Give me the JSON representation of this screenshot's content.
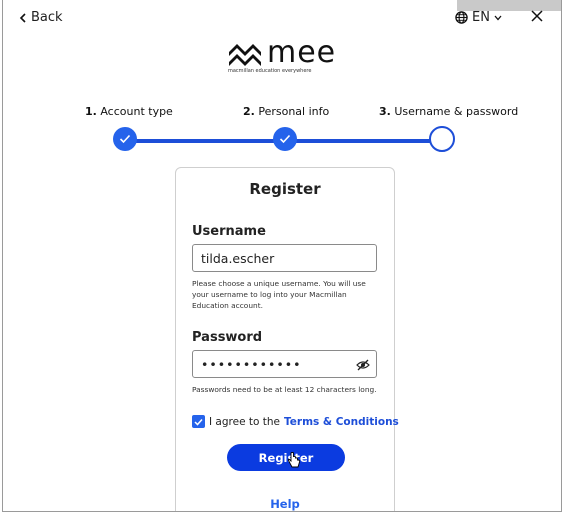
{
  "topbar": {
    "back_label": "Back",
    "language_label": "EN"
  },
  "brand": {
    "wordmark": "mee",
    "tagline": "macmillan education everywhere"
  },
  "steps": [
    {
      "number": "1.",
      "label": "Account type",
      "state": "done"
    },
    {
      "number": "2.",
      "label": "Personal info",
      "state": "done"
    },
    {
      "number": "3.",
      "label": "Username & password",
      "state": "current"
    }
  ],
  "form": {
    "title": "Register",
    "username": {
      "label": "Username",
      "value": "tilda.escher",
      "hint": "Please choose a unique username. You will use your username to log into your Macmillan Education account."
    },
    "password": {
      "label": "Password",
      "value": "••••••••••••",
      "hint": "Passwords need to be at least 12 characters long."
    },
    "agree": {
      "prefix": "I agree to the",
      "link": "Terms & Conditions",
      "checked": true
    },
    "register_label": "Register",
    "help_label": "Help"
  },
  "colors": {
    "accent": "#1d4ed8",
    "button": "#0b3be0",
    "step_done": "#2563eb"
  },
  "icons": {
    "back": "chevron-left-icon",
    "language": "globe-icon",
    "language_dropdown": "chevron-down-icon",
    "close": "close-icon",
    "password_visibility": "eye-slash-icon",
    "checkmark": "check-icon",
    "cursor": "hand-pointer-icon"
  }
}
